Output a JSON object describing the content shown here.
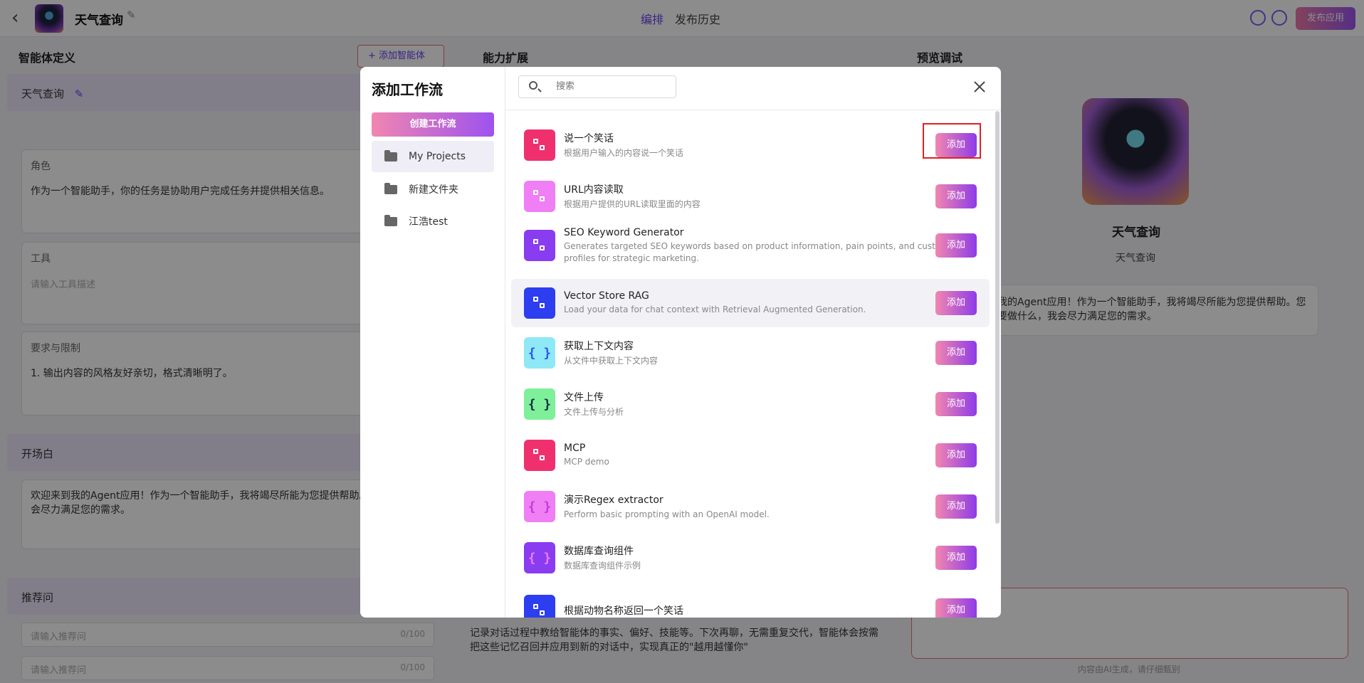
{
  "header": {
    "title": "天气查询",
    "tabs": [
      "编排",
      "发布历史"
    ],
    "publish_label": "发布应用"
  },
  "columns": {
    "agent_def": "智能体定义",
    "ability": "能力扩展",
    "preview": "预览调试",
    "add_agent_label": "添加智能体"
  },
  "left": {
    "agent_name": "天气查询",
    "role_label": "角色",
    "role_text": "作为一个智能助手，你的任务是协助用户完成任务并提供相关信息。",
    "tool_label": "工具",
    "tool_placeholder": "请输入工具描述",
    "constraints_label": "要求与限制",
    "constraints_text": "1. 输出内容的风格友好亲切，格式清晰明了。",
    "opening_label": "开场白",
    "opening_text": "欢迎来到我的Agent应用！作为一个智能助手，我将竭尽所能为您提供帮助。需要做什么，我会尽力满足您的需求。",
    "suggest_label": "推荐问",
    "suggest_placeholder": "请输入推荐问",
    "suggest_counter": "0/100"
  },
  "middle": {
    "memory_text": "记录对话过程中教给智能体的事实、偏好、技能等。下次再聊，无需重复交代，智能体会按需把这些记忆召回并应用到新的对话中，实现真正的\"越用越懂你\""
  },
  "preview": {
    "name": "天气查询",
    "subtitle": "天气查询",
    "greeting": "到我的Agent应用！作为一个智能助手，我将竭尽所能为您提供帮助。您需要做什么，我会尽力满足您的需求。",
    "ai_note": "内容由AI生成，请仔细甄别"
  },
  "modal": {
    "title": "添加工作流",
    "create_label": "创建工作流",
    "search_placeholder": "搜索",
    "folders": [
      "My Projects",
      "新建文件夹",
      "江浩test"
    ],
    "add_label": "添加",
    "items": [
      {
        "name": "说一个笑话",
        "desc": "根据用户输入的内容说一个笑话",
        "icon": "flow-icon",
        "color": "#f0306e"
      },
      {
        "name": "URL内容读取",
        "desc": "根据用户提供的URL读取里面的内容",
        "icon": "flow-icon",
        "color": "#f07ef5"
      },
      {
        "name": "SEO Keyword Generator",
        "desc": "Generates targeted SEO keywords based on product information, pain points, and customer profiles for strategic marketing.",
        "icon": "flow-icon",
        "color": "#8a3cf0"
      },
      {
        "name": "Vector Store RAG",
        "desc": "Load your data for chat context with Retrieval Augmented Generation.",
        "icon": "flow-icon",
        "color": "#2d3df0"
      },
      {
        "name": "获取上下文内容",
        "desc": "从文件中获取上下文内容",
        "icon": "braces-icon",
        "color": "#8ee8f5"
      },
      {
        "name": "文件上传",
        "desc": "文件上传与分析",
        "icon": "braces-icon",
        "color": "#7ef09a"
      },
      {
        "name": "MCP",
        "desc": "MCP demo",
        "icon": "flow-icon",
        "color": "#f0306e"
      },
      {
        "name": "演示Regex extractor",
        "desc": "Perform basic prompting with an OpenAI model.",
        "icon": "braces-icon",
        "color": "#f07ef5"
      },
      {
        "name": "数据库查询组件",
        "desc": "数据库查询组件示例",
        "icon": "braces-icon",
        "color": "#8a3cf0"
      },
      {
        "name": "根据动物名称返回一个笑话",
        "desc": "",
        "icon": "flow-icon",
        "color": "#2d3df0"
      }
    ]
  }
}
